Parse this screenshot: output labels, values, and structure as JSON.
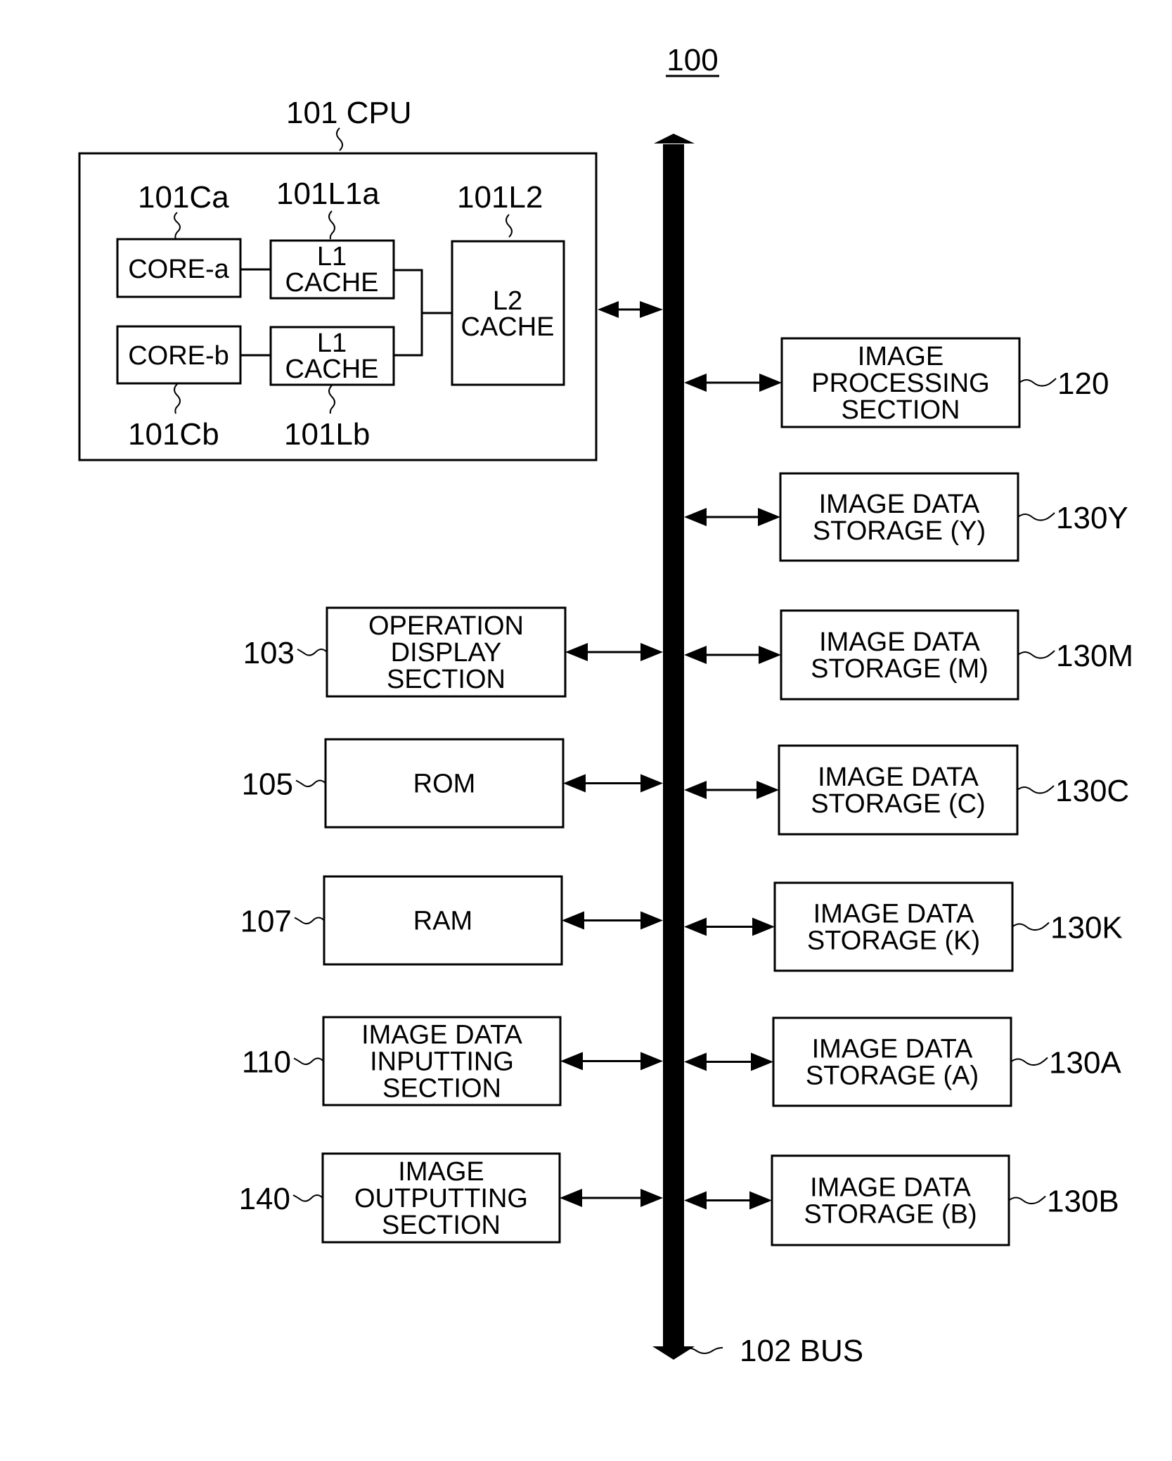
{
  "figure": {
    "reference": "100",
    "bus": {
      "ref": "102 BUS"
    },
    "cpu": {
      "ref": "101 CPU",
      "core_a": {
        "ref": "101Ca",
        "lines": [
          "CORE-a"
        ]
      },
      "core_b": {
        "ref": "101Cb",
        "lines": [
          "CORE-b"
        ]
      },
      "l1_a": {
        "ref": "101L1a",
        "lines": [
          "L1",
          "CACHE"
        ]
      },
      "l1_b": {
        "ref": "101Lb",
        "lines": [
          "L1",
          "CACHE"
        ]
      },
      "l2": {
        "ref": "101L2",
        "lines": [
          "L2",
          "CACHE"
        ]
      }
    },
    "left_blocks": [
      {
        "ref": "103",
        "lines": [
          "OPERATION",
          "DISPLAY",
          "SECTION"
        ]
      },
      {
        "ref": "105",
        "lines": [
          "ROM"
        ]
      },
      {
        "ref": "107",
        "lines": [
          "RAM"
        ]
      },
      {
        "ref": "110",
        "lines": [
          "IMAGE DATA",
          "INPUTTING",
          "SECTION"
        ]
      },
      {
        "ref": "140",
        "lines": [
          "IMAGE",
          "OUTPUTTING",
          "SECTION"
        ]
      }
    ],
    "right_blocks": [
      {
        "ref": "120",
        "lines": [
          "IMAGE",
          "PROCESSING",
          "SECTION"
        ]
      },
      {
        "ref": "130Y",
        "lines": [
          "IMAGE DATA",
          "STORAGE (Y)"
        ]
      },
      {
        "ref": "130M",
        "lines": [
          "IMAGE DATA",
          "STORAGE (M)"
        ]
      },
      {
        "ref": "130C",
        "lines": [
          "IMAGE DATA",
          "STORAGE (C)"
        ]
      },
      {
        "ref": "130K",
        "lines": [
          "IMAGE DATA",
          "STORAGE (K)"
        ]
      },
      {
        "ref": "130A",
        "lines": [
          "IMAGE DATA",
          "STORAGE (A)"
        ]
      },
      {
        "ref": "130B",
        "lines": [
          "IMAGE DATA",
          "STORAGE (B)"
        ]
      }
    ]
  }
}
